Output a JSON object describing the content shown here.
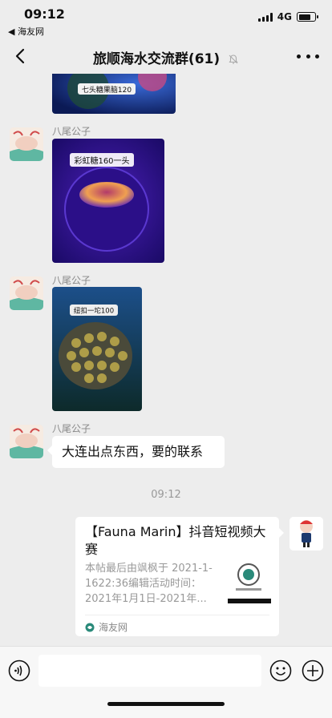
{
  "status_bar": {
    "time": "09:12",
    "back_app": "◀ 海友网",
    "network": "4G",
    "battery_level": 0.75
  },
  "nav": {
    "title": "旅顺海水交流群(61)"
  },
  "messages": [
    {
      "type": "image",
      "caption": "七头糖果脑120"
    },
    {
      "type": "image",
      "sender": "八尾公子",
      "caption": "彩虹糖160一头"
    },
    {
      "type": "image",
      "sender": "八尾公子",
      "caption": "纽扣一坨100"
    },
    {
      "type": "text",
      "sender": "八尾公子",
      "text": "大连出点东西，要的联系"
    }
  ],
  "timestamp": "09:12",
  "link_card": {
    "title": "【Fauna Marin】抖音短视频大赛",
    "description": "本帖最后由飒枫于 2021-1-1622:36编辑活动时间：2021年1月1日-2021年...",
    "source": "海友网"
  },
  "colors": {
    "chat_bg": "#ededed",
    "bubble": "#ffffff",
    "meta_text": "#888888"
  }
}
